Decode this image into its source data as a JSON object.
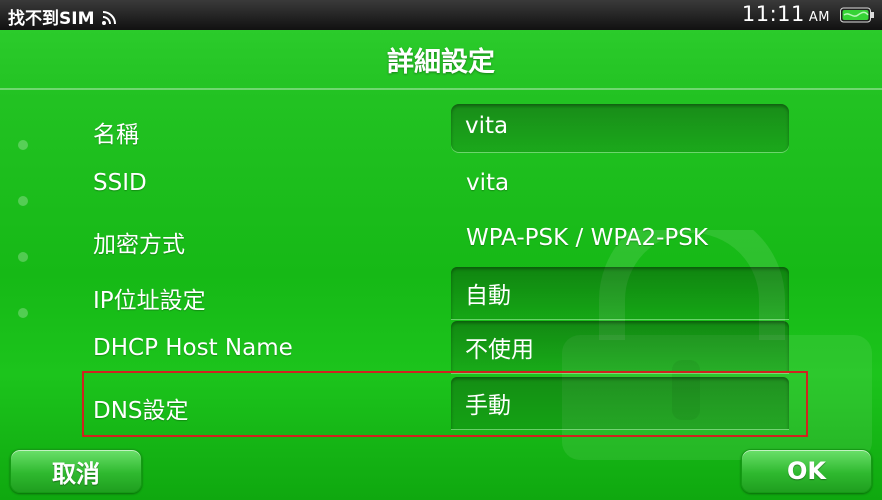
{
  "status_bar": {
    "carrier": "找不到SIM",
    "time": "11:11",
    "ampm": "AM"
  },
  "title": "詳細設定",
  "rows": [
    {
      "label": "名稱",
      "value": "vita"
    },
    {
      "label": "SSID",
      "value": "vita"
    },
    {
      "label": "加密方式",
      "value": "WPA-PSK / WPA2-PSK"
    },
    {
      "label": "IP位址設定",
      "value": "自動"
    },
    {
      "label": "DHCP Host Name",
      "value": "不使用"
    },
    {
      "label": "DNS設定",
      "value": "手動"
    }
  ],
  "buttons": {
    "cancel": "取消",
    "ok": "OK"
  },
  "colors": {
    "background": "#16b916",
    "highlight_border": "#d0231f",
    "button": "#2fb92f"
  },
  "icons": [
    "wifi-icon",
    "battery-icon",
    "lock-icon"
  ]
}
